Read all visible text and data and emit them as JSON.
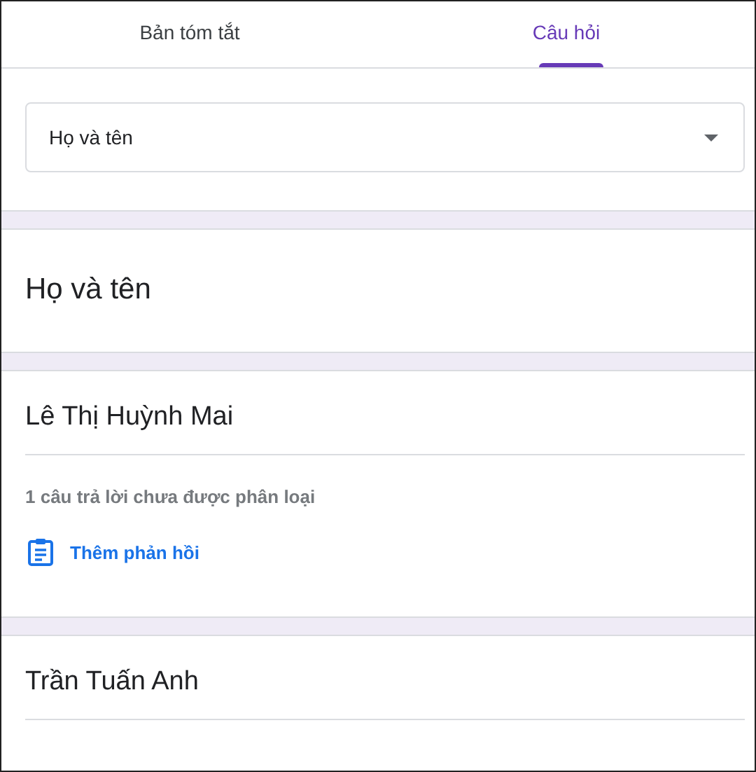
{
  "tabs": [
    {
      "label": "Bản tóm tắt",
      "selected": false
    },
    {
      "label": "Câu hỏi",
      "selected": true
    }
  ],
  "question_select": {
    "value": "Họ và tên"
  },
  "question_title": "Họ và tên",
  "answers": [
    {
      "name": "Lê Thị Huỳnh Mai",
      "note": "1 câu trả lời chưa được phân loại",
      "action": "Thêm phản hồi"
    },
    {
      "name": "Trần Tuấn Anh"
    }
  ]
}
